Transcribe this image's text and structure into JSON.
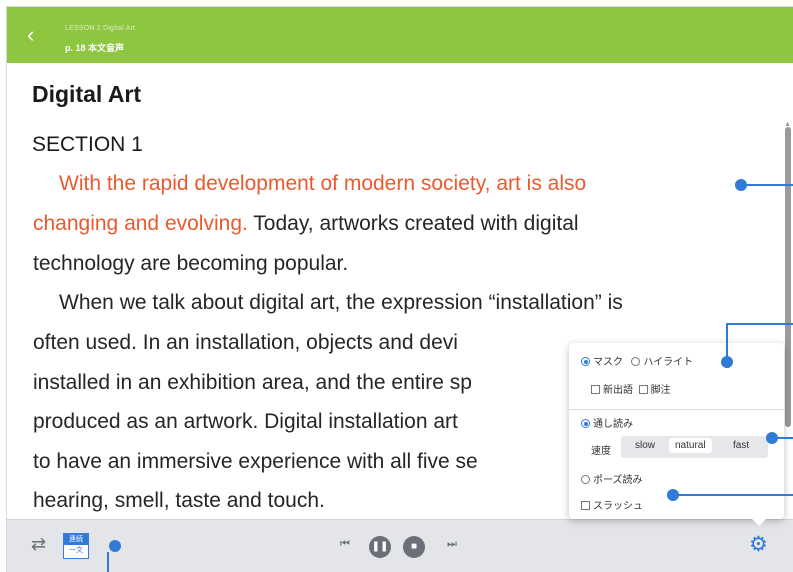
{
  "header": {
    "back_icon": "chevron-left-icon",
    "lesson": "LESSON 2  Digital Art",
    "page_title": "p. 18 本文音声",
    "color": "#8dc63f"
  },
  "content": {
    "title": "Digital Art",
    "section": "SECTION 1",
    "highlight_color": "#e95a2e",
    "lines": [
      {
        "hl": "With the rapid development of modern society, art is also",
        "rest": ""
      },
      {
        "hl": "changing and evolving.",
        "rest": "  Today, artworks created with digital"
      },
      {
        "hl": "",
        "rest": "technology are becoming popular."
      },
      {
        "hl": "",
        "rest": "When we talk about digital art, the expression “installation” is"
      },
      {
        "hl": "",
        "rest": "often used.  In an installation, objects and devi"
      },
      {
        "hl": "",
        "rest": "installed in an exhibition area, and the entire sp"
      },
      {
        "hl": "",
        "rest": "produced as an artwork.  Digital installation art"
      },
      {
        "hl": "",
        "rest": "to have an immersive experience with all five se"
      },
      {
        "hl": "",
        "rest": "hearing, smell, taste and touch."
      }
    ]
  },
  "settings_panel": {
    "mask": "マスク",
    "highlight": "ハイライト",
    "new_words": "新出語",
    "footnote": "脚注",
    "continuous": "通し読み",
    "speed_label": "速度",
    "speeds": [
      "slow",
      "natural",
      "fast"
    ],
    "selected_speed": "natural",
    "pause_reading": "ポーズ読み",
    "slash": "スラッシュ"
  },
  "footer": {
    "repeat_icon": "repeat-icon",
    "renzoku_top": "連続",
    "renzoku_bottom": "一文",
    "prev_icon": "skip-previous-icon",
    "pause_icon": "pause-icon",
    "stop_icon": "stop-icon",
    "next_icon": "skip-next-icon",
    "settings_icon": "gear-icon",
    "accent": "#2f7bd6"
  }
}
